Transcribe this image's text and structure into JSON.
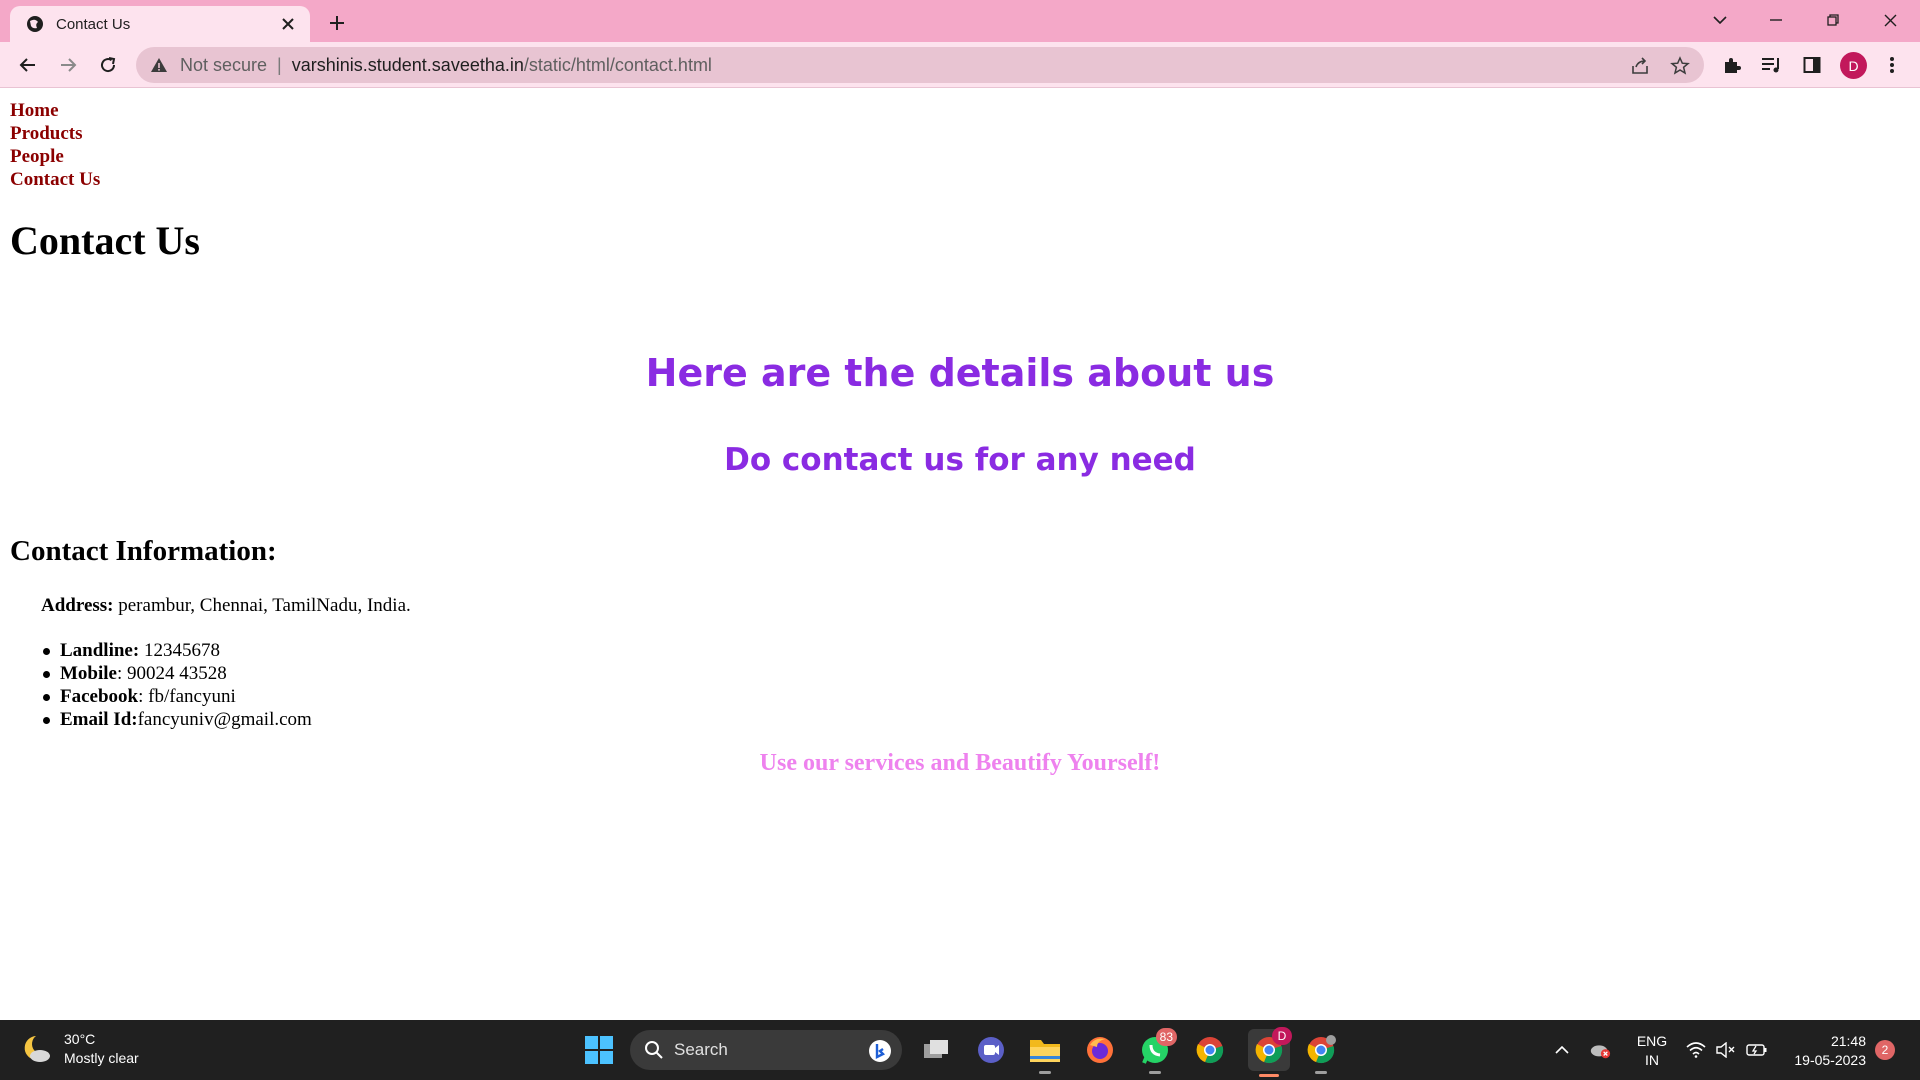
{
  "browser": {
    "tab_title": "Contact Us",
    "security_label": "Not secure",
    "separator": "|",
    "url_host": "varshinis.student.saveetha.in",
    "url_path": "/static/html/contact.html",
    "profile_initial": "D",
    "accent_color": "#f4a8c8"
  },
  "nav": {
    "links": [
      "Home",
      "Products",
      "People",
      "Contact Us"
    ]
  },
  "page": {
    "title": "Contact Us",
    "details_heading": "Here are the details about us",
    "contact_need": "Do contact us for any need",
    "info_title": "Contact Information:",
    "address_label": "Address:",
    "address_value": " perambur, Chennai, TamilNadu, India.",
    "contacts": [
      {
        "label": "Landline:",
        "value": " 12345678"
      },
      {
        "label": "Mobile",
        "value": ": 90024 43528"
      },
      {
        "label": "Facebook",
        "value": ": fb/fancyuni"
      },
      {
        "label": "Email Id:",
        "value": "fancyuniv@gmail.com"
      }
    ],
    "slogan": "Use our services and Beautify Yourself!",
    "heading_color": "#8a2be2",
    "slogan_color": "#ee82ee",
    "nav_color": "#8b0000"
  },
  "taskbar": {
    "weather_temp": "30°C",
    "weather_desc": "Mostly clear",
    "search_placeholder": "Search",
    "whatsapp_badge": "83",
    "chrome_profile_badge": "D",
    "lang_line1": "ENG",
    "lang_line2": "IN",
    "time": "21:48",
    "date": "19-05-2023",
    "notification_count": "2"
  }
}
